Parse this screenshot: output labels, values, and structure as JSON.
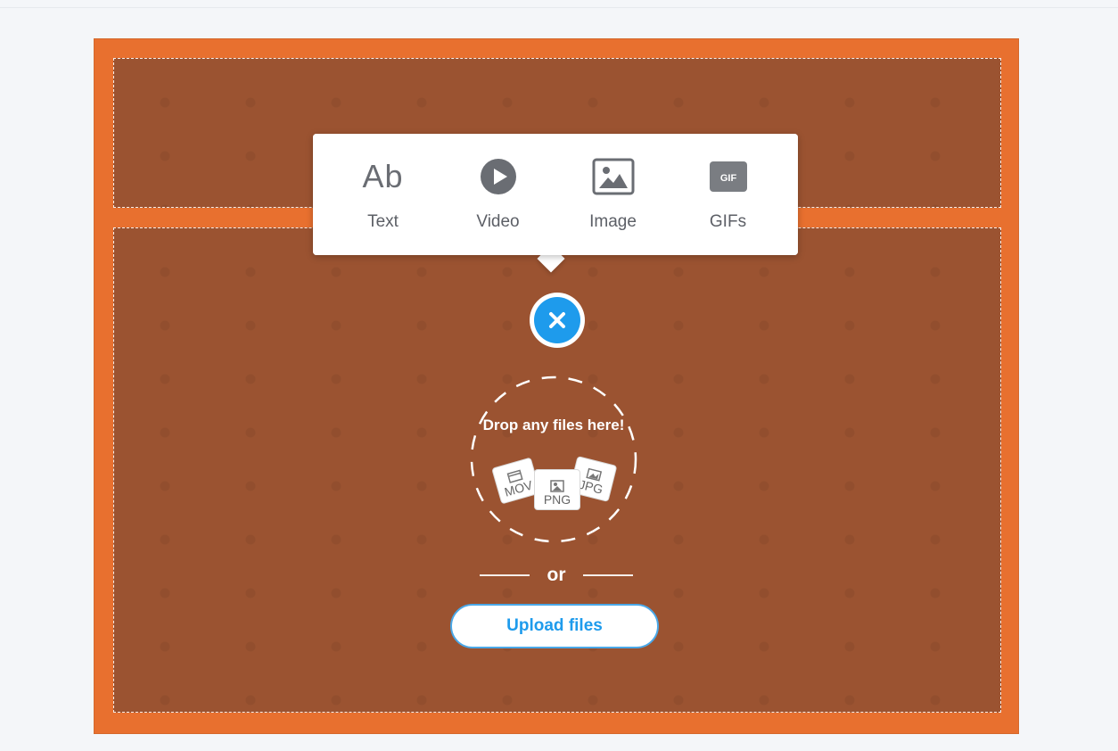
{
  "popover": {
    "items": [
      {
        "label": "Text",
        "icon": "text-ab-icon",
        "glyph": "Ab"
      },
      {
        "label": "Video",
        "icon": "video-play-icon"
      },
      {
        "label": "Image",
        "icon": "image-icon"
      },
      {
        "label": "GIFs",
        "icon": "gif-icon",
        "glyph": "GIF"
      }
    ]
  },
  "close_button": {
    "icon": "close-icon"
  },
  "dropzone": {
    "text": "Drop any files here!",
    "files": [
      "MOV",
      "PNG",
      "JPG"
    ]
  },
  "divider_text": "or",
  "upload_button": {
    "label": "Upload files"
  },
  "colors": {
    "board_border": "#e8702f",
    "zone_fill": "#9b5331",
    "accent": "#1e9bec"
  }
}
